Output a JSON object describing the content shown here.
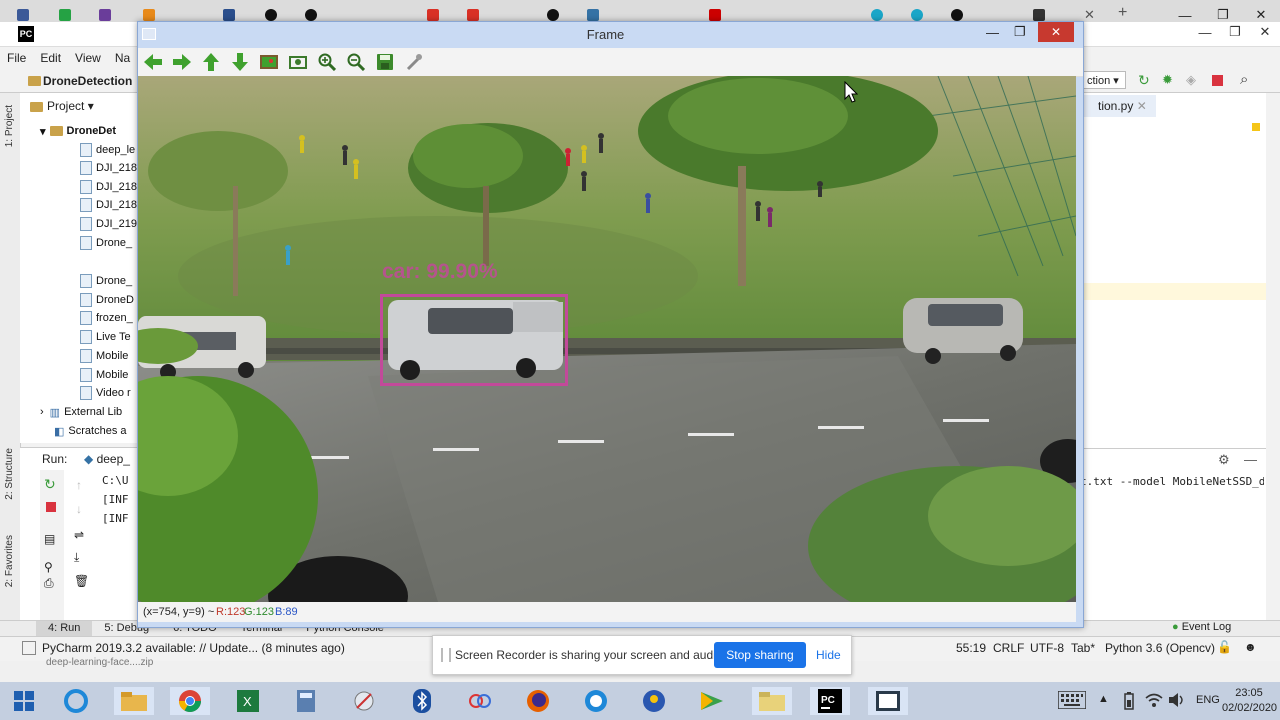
{
  "frame_window": {
    "title": "Frame",
    "detection_label": "car: 99.90%",
    "status_coords": "(x=754, y=9) ~",
    "status_r": "R:123",
    "status_g": "G:123",
    "status_b": "B:89"
  },
  "pycharm": {
    "logo": "PC",
    "menu": [
      "File",
      "Edit",
      "View",
      "Na"
    ],
    "project_name": "DroneDetection",
    "project_label": "Project",
    "config_dropdown": "ction",
    "editor_tab": "tion.py",
    "tree": [
      "DroneDet",
      "deep_le",
      "DJI_218",
      "DJI_218",
      "DJI_218",
      "DJI_219",
      "Drone_",
      "Drone_",
      "DroneD",
      "frozen_",
      "Live Te",
      "Mobile",
      "Mobile",
      "Video r",
      "External Lib",
      "Scratches a"
    ],
    "run_label": "Run:",
    "run_tab": "deep_",
    "console_lines": [
      "C:\\U",
      "[INF",
      "[INF"
    ],
    "console_right": "t.txt --model MobileNetSSD_d",
    "side_labels": [
      "1: Project",
      "2: Structure",
      "2: Favorites"
    ],
    "bottom_tabs": [
      "4: Run",
      "5: Debug",
      "6: TODO",
      "Terminal",
      "Python Console"
    ],
    "event_log": "Event Log",
    "status_message": "PyCharm 2019.3.2 available: // Update... (8 minutes ago)",
    "status_position": "55:19",
    "status_crlf": "CRLF",
    "status_encoding": "UTF-8",
    "status_tab": "Tab*",
    "status_interpreter": "Python 3.6 (Opencv)",
    "download_name": "deep-learning-face....zip"
  },
  "share_bar": {
    "message": "Screen Recorder is sharing your screen and audio.",
    "stop_label": "Stop sharing",
    "hide_label": "Hide"
  },
  "taskbar": {
    "language": "ENG",
    "time": "23:05",
    "date": "02/02/2020"
  },
  "colors": {
    "detection_box": "#c24a9a",
    "frame_border": "#8aa7d4",
    "share_button": "#1a73e8"
  }
}
